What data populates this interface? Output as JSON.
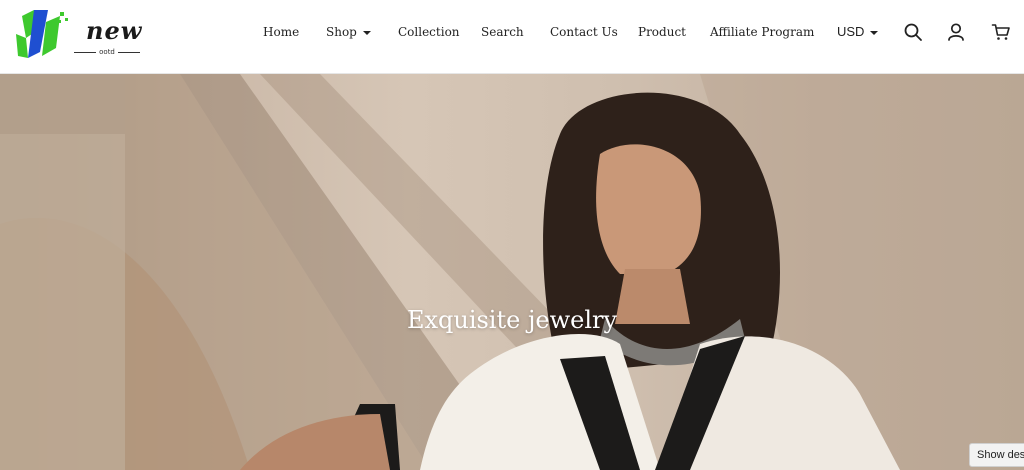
{
  "brand": {
    "word": "new",
    "sub": "ootd"
  },
  "nav": {
    "items": [
      {
        "label": "Home"
      },
      {
        "label": "Shop"
      },
      {
        "label": "Collection"
      },
      {
        "label": "Search"
      },
      {
        "label": "Contact Us"
      },
      {
        "label": "Product"
      },
      {
        "label": "Affiliate Program"
      }
    ],
    "currency": "USD"
  },
  "icons": {
    "search": "search-icon",
    "account": "user-icon",
    "cart": "cart-icon",
    "shop_dropdown": "chevron-down-icon",
    "currency_dropdown": "chevron-down-icon"
  },
  "colors": {
    "logo_green": "#3ec92e",
    "logo_blue": "#1f4fd1",
    "text": "#222222",
    "hero_text": "#ffffff"
  },
  "hero": {
    "title": "Exquisite jewelry"
  },
  "floating": {
    "show_desktop_label": "Show desktop"
  }
}
